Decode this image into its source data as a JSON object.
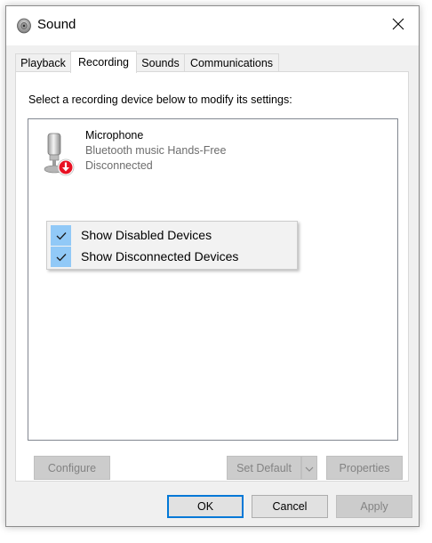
{
  "window": {
    "title": "Sound",
    "close_icon": "close-icon",
    "app_icon": "speaker-icon"
  },
  "tabs": [
    {
      "label": "Playback",
      "active": false
    },
    {
      "label": "Recording",
      "active": true
    },
    {
      "label": "Sounds",
      "active": false
    },
    {
      "label": "Communications",
      "active": false
    }
  ],
  "recording": {
    "instruction": "Select a recording device below to modify its settings:",
    "devices": [
      {
        "name": "Microphone",
        "description": "Bluetooth music Hands-Free",
        "status": "Disconnected",
        "icon": "microphone-icon",
        "status_icon": "disconnected-down-arrow-icon",
        "status_color": "#e81123"
      }
    ]
  },
  "context_menu": {
    "items": [
      {
        "label": "Show Disabled Devices",
        "checked": true
      },
      {
        "label": "Show Disconnected Devices",
        "checked": true
      }
    ]
  },
  "panel_buttons": {
    "configure": "Configure",
    "set_default": "Set Default",
    "properties": "Properties"
  },
  "dialog_buttons": {
    "ok": "OK",
    "cancel": "Cancel",
    "apply": "Apply"
  },
  "colors": {
    "accent": "#0078d7",
    "menu_check_bg": "#91c9f7",
    "disabled_text": "#838383"
  }
}
